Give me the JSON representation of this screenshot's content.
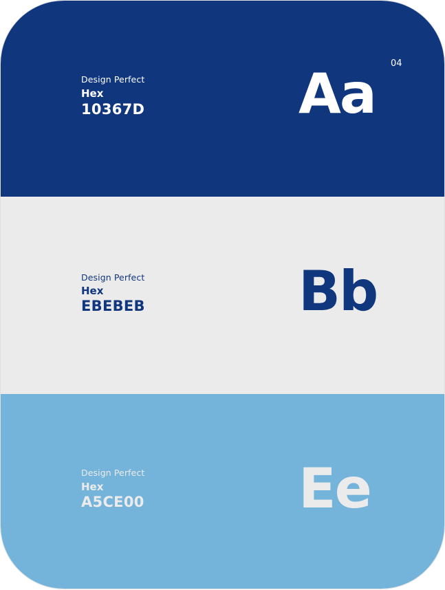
{
  "page_number": "04",
  "swatches": [
    {
      "label": "Design Perfect",
      "hex_label": "Hex",
      "code": "10367D",
      "glyph": "Aa",
      "background": "#10367D",
      "text_color": "#FFFFFF",
      "glyph_color": "#FFFFFF"
    },
    {
      "label": "Design Perfect",
      "hex_label": "Hex",
      "code": "EBEBEB",
      "glyph": "Bb",
      "background": "#EBEBEB",
      "text_color": "#10367D",
      "glyph_color": "#10367D"
    },
    {
      "label": "Design Perfect",
      "hex_label": "Hex",
      "code": "A5CE00",
      "glyph": "Ee",
      "background": "#74B3DA",
      "text_color": "#EBEBEB",
      "glyph_color": "#EBEBEB"
    }
  ]
}
